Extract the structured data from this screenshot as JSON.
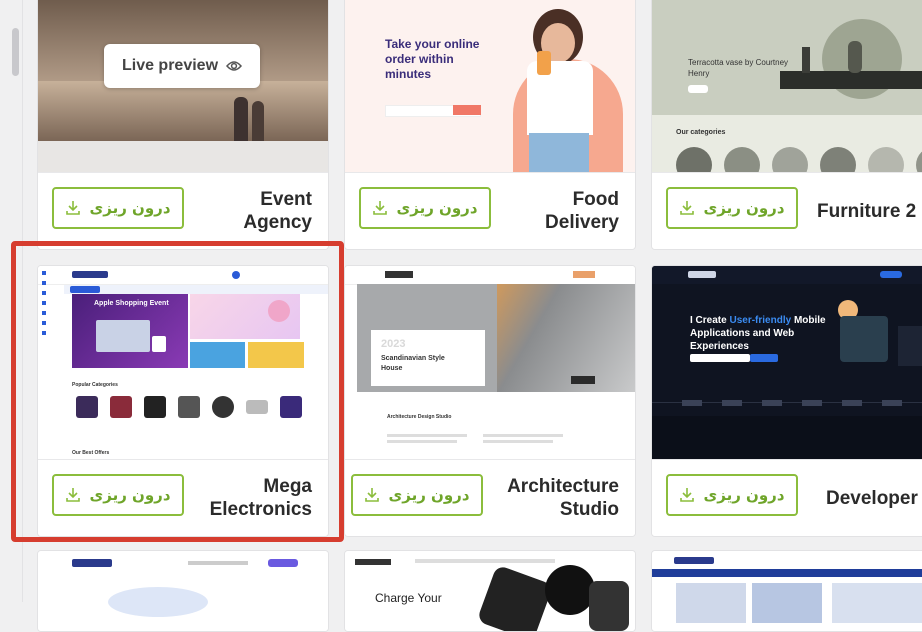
{
  "cards": [
    {
      "title_line1": "Event",
      "title_line2": "Agency",
      "button": "درون ریزی",
      "live_preview": "Live preview"
    },
    {
      "title_line1": "Food",
      "title_line2": "Delivery",
      "button": "درون ریزی",
      "hero_text": "Take your online order within minutes"
    },
    {
      "title_line1": "Furniture 2",
      "title_line2": "",
      "button": "درون ریزی",
      "hero_text": "Terracotta vase by Courtney Henry",
      "section": "Our categories"
    },
    {
      "title_line1": "Mega",
      "title_line2": "Electronics",
      "button": "درون ریزی",
      "hero_text": "Apple Shopping Event",
      "section": "Popular Categories",
      "section2": "Our Best Offers"
    },
    {
      "title_line1": "Architecture",
      "title_line2": "Studio",
      "button": "درون ریزی",
      "year": "2023",
      "hero_text": "Scandinavian Style House",
      "section": "Architecture Design Studio"
    },
    {
      "title_line1": "Developer",
      "title_line2": "",
      "button": "درون ریزی",
      "hero_a": "I Create ",
      "hero_b": "User-friendly",
      "hero_c": "Mobile Applications and Web Experiences"
    },
    {
      "title_line1": "",
      "title_line2": "",
      "button": ""
    },
    {
      "title_line1": "",
      "title_line2": "",
      "button": "",
      "hero_text": "Charge Your"
    },
    {
      "title_line1": "",
      "title_line2": "",
      "button": ""
    }
  ],
  "colors": {
    "accent_green": "#8bbd3c",
    "highlight_red": "#d63d2f"
  }
}
